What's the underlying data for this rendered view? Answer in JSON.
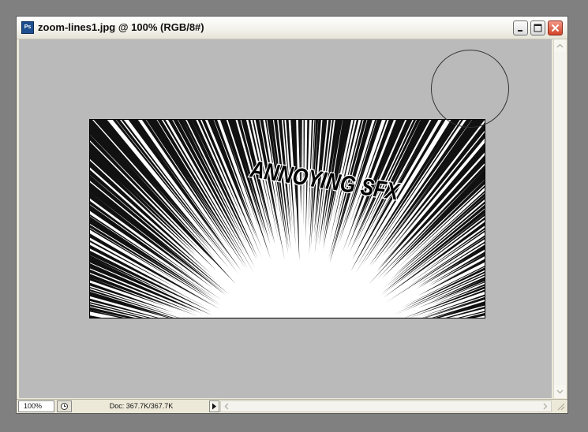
{
  "window": {
    "title": "zoom-lines1.jpg @ 100% (RGB/8#)",
    "app_icon": "photoshop-document-icon",
    "buttons": {
      "minimize": "minimize-icon",
      "maximize": "maximize-icon",
      "close": "close-icon"
    }
  },
  "document": {
    "sfx_text": "ANNOYING SFX"
  },
  "status": {
    "zoom": "100%",
    "doc_info": "Doc: 367.7K/367.7K"
  },
  "colors": {
    "workspace": "#bababa",
    "desktop": "#808080",
    "close_button": "#d2452a"
  }
}
